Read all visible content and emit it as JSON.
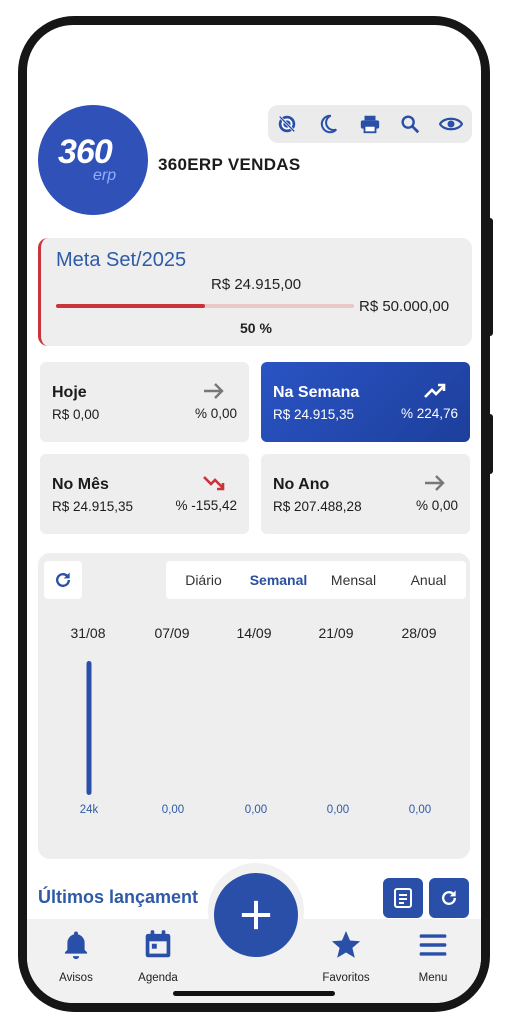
{
  "header": {
    "company_name": "360ERP VENDAS",
    "logo_text": "360",
    "logo_sub": "erp",
    "toolbar_icons": [
      "no-location-icon",
      "moon-icon",
      "print-icon",
      "search-icon",
      "eye-icon"
    ]
  },
  "meta": {
    "title": "Meta Set/2025",
    "current": "R$ 24.915,00",
    "target": "R$ 50.000,00",
    "percent_label": "50 %",
    "progress": 0.5,
    "accent": "#c9333a"
  },
  "stats": [
    {
      "title": "Hoje",
      "value": "R$ 0,00",
      "pct": "% 0,00",
      "trend": "flat"
    },
    {
      "title": "Na Semana",
      "value": "R$ 24.915,35",
      "pct": "% 224,76",
      "trend": "up"
    },
    {
      "title": "No Mês",
      "value": "R$ 24.915,35",
      "pct": "% -155,42",
      "trend": "down"
    },
    {
      "title": "No Ano",
      "value": "R$ 207.488,28",
      "pct": "% 0,00",
      "trend": "flat"
    }
  ],
  "chart": {
    "tabs": [
      "Diário",
      "Semanal",
      "Mensal",
      "Anual"
    ],
    "selected_tab": "Semanal"
  },
  "chart_data": {
    "type": "bar",
    "categories": [
      "31/08",
      "07/09",
      "14/09",
      "21/09",
      "28/09"
    ],
    "values": [
      24915,
      0,
      0,
      0,
      0
    ],
    "value_labels": [
      "24k",
      "0,00",
      "0,00",
      "0,00",
      "0,00"
    ],
    "ylim": [
      0,
      24915
    ],
    "color": "#2a4fa8"
  },
  "recent": {
    "title": "Últimos lançament"
  },
  "nav": {
    "items": [
      {
        "label": "Avisos",
        "icon": "bell-icon"
      },
      {
        "label": "Agenda",
        "icon": "calendar-icon"
      },
      {
        "label": "Favoritos",
        "icon": "star-icon"
      },
      {
        "label": "Menu",
        "icon": "menu-icon"
      }
    ],
    "fab_icon": "plus-icon"
  },
  "colors": {
    "primary": "#2a4fa8",
    "title_blue": "#2f5aa8",
    "danger": "#c9333a"
  }
}
